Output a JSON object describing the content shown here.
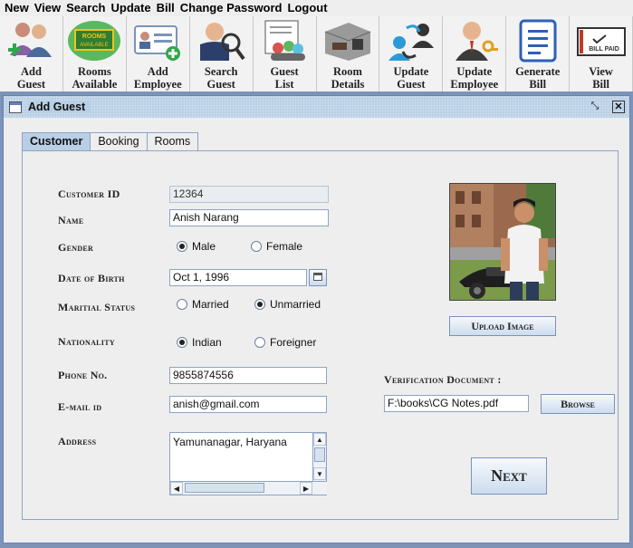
{
  "menubar": {
    "items": [
      "New",
      "View",
      "Search",
      "Update",
      "Bill",
      "Change Password",
      "Logout"
    ]
  },
  "toolbar": {
    "tools": [
      {
        "label": "Add\nGuest",
        "icon": "add-guest-icon"
      },
      {
        "label": "Rooms\nAvailable",
        "icon": "rooms-available-icon"
      },
      {
        "label": "Add\nEmployee",
        "icon": "add-employee-icon"
      },
      {
        "label": "Search\nGuest",
        "icon": "search-guest-icon"
      },
      {
        "label": "Guest\nList",
        "icon": "guest-list-icon"
      },
      {
        "label": "Room\nDetails",
        "icon": "room-details-icon"
      },
      {
        "label": "Update\nGuest",
        "icon": "update-guest-icon"
      },
      {
        "label": "Update\nEmployee",
        "icon": "update-employee-icon"
      },
      {
        "label": "Generate\nBill",
        "icon": "generate-bill-icon"
      },
      {
        "label": "View\nBill",
        "icon": "view-bill-icon"
      }
    ],
    "rooms_sign_text": "ROOMS\nAVAILABLE",
    "bill_paid_text": "BILL PAID"
  },
  "frame": {
    "title": "Add Guest",
    "tabs": [
      "Customer",
      "Booking",
      "Rooms"
    ],
    "active_tab": "Customer"
  },
  "form": {
    "customer_id_label": "Customer ID",
    "customer_id_value": "12364",
    "name_label": "Name",
    "name_value": "Anish Narang",
    "gender_label": "Gender",
    "gender_male": "Male",
    "gender_female": "Female",
    "gender_selected": "Male",
    "dob_label": "Date of Birth",
    "dob_value": "Oct 1, 1996",
    "marital_label": "Maritial Status",
    "marital_married": "Married",
    "marital_unmarried": "Unmarried",
    "marital_selected": "Unmarried",
    "nationality_label": "Nationality",
    "nationality_indian": "Indian",
    "nationality_foreigner": "Foreigner",
    "nationality_selected": "Indian",
    "phone_label": "Phone No.",
    "phone_value": "9855874556",
    "email_label": "E-mail id",
    "email_value": "anish@gmail.com",
    "address_label": "Address",
    "address_value": "Yamunanagar, Haryana",
    "upload_label": "Upload Image",
    "verification_label": "Verification Document :",
    "verification_value": "F:\\books\\CG Notes.pdf",
    "browse_label": "Browse",
    "next_label": "Next"
  },
  "colors": {
    "desktop": "#7f93b7",
    "frame_title": "#b8cfe5",
    "border": "#8fa3c2"
  }
}
